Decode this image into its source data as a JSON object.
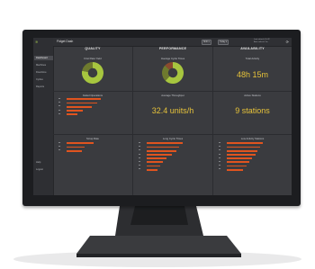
{
  "app": {
    "title": "Fidget Dash"
  },
  "sidebar": {
    "logo": "≋",
    "items": [
      {
        "label": "Dashboard",
        "active": true
      },
      {
        "label": "Machines",
        "active": false
      },
      {
        "label": "Downtime",
        "active": false
      },
      {
        "label": "Cycles",
        "active": false
      },
      {
        "label": "Reports",
        "active": false
      }
    ],
    "bottom": [
      {
        "label": "Help"
      },
      {
        "label": "Logout"
      }
    ]
  },
  "topbar": {
    "dropdown1": "Shift ▾",
    "dropdown2": "Today ▾",
    "timestamp_line1": "Last refresh 10:42",
    "timestamp_line2": "Auto refresh 1m",
    "refresh_icon": "⟳"
  },
  "columns": {
    "quality": {
      "heading": "QUALITY",
      "panel1_title": "First Pass Yield",
      "panel2_title": "Failed Operations",
      "panel3_title": "Scrap Rate"
    },
    "performance": {
      "heading": "PERFORMANCE",
      "panel1_title": "Average Cycle Times",
      "panel2_title": "Average Throughput",
      "throughput": "32.4 units/h",
      "panel3_title": "Long Cycle Times"
    },
    "availability": {
      "heading": "AVAILABILITY",
      "panel1_title": "Total Activity",
      "total_activity": "48h 15m",
      "panel2_title": "Active Stations",
      "active_stations": "9 stations",
      "panel3_title": "Low Activity Stations"
    }
  },
  "colors": {
    "accent_yellow": "#e6c23a",
    "donut_green": "#a7c63f",
    "donut_olive": "#6e7a2e",
    "bar_orange": "#e0541f"
  },
  "chart_data": [
    {
      "type": "pie",
      "title": "First Pass Yield",
      "values": [
        78,
        22
      ]
    },
    {
      "type": "pie",
      "title": "Average Cycle Times",
      "values": [
        62,
        25,
        13
      ]
    },
    {
      "type": "bar",
      "title": "Failed Operations",
      "values": [
        95,
        85,
        70,
        45,
        30
      ]
    },
    {
      "type": "bar",
      "title": "Scrap Rate",
      "values": [
        90,
        60,
        50
      ]
    },
    {
      "type": "bar",
      "title": "Long Cycle Times",
      "values": [
        100,
        90,
        82,
        70,
        55,
        45,
        38,
        30
      ]
    },
    {
      "type": "bar",
      "title": "Low Activity Stations",
      "values": [
        100,
        92,
        85,
        80,
        70,
        62,
        55,
        45
      ]
    }
  ]
}
